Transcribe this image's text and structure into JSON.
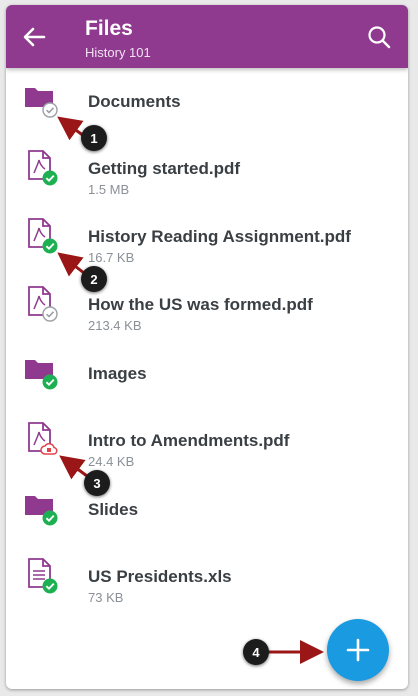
{
  "header": {
    "title": "Files",
    "subtitle": "History 101"
  },
  "colors": {
    "appbar": "#8f3a8e",
    "accent": "#8f3a8e",
    "synced": "#1db052",
    "unsynced": "#9aa0a6",
    "error": "#e0434a",
    "fab": "#1a9ae0",
    "callout_arrow": "#9b1616"
  },
  "files": [
    {
      "name": "Documents",
      "size": "",
      "kind": "folder",
      "status": "unsynced"
    },
    {
      "name": "Getting started.pdf",
      "size": "1.5 MB",
      "kind": "pdf",
      "status": "synced"
    },
    {
      "name": "History Reading Assignment.pdf",
      "size": "16.7 KB",
      "kind": "pdf",
      "status": "synced"
    },
    {
      "name": "How the US was formed.pdf",
      "size": "213.4 KB",
      "kind": "pdf",
      "status": "unsynced"
    },
    {
      "name": "Images",
      "size": "",
      "kind": "folder",
      "status": "synced"
    },
    {
      "name": "Intro to Amendments.pdf",
      "size": "24.4 KB",
      "kind": "pdf",
      "status": "error"
    },
    {
      "name": "Slides",
      "size": "",
      "kind": "folder",
      "status": "synced"
    },
    {
      "name": "US Presidents.xls",
      "size": "73 KB",
      "kind": "xls",
      "status": "synced"
    }
  ],
  "callouts": [
    "1",
    "2",
    "3",
    "4"
  ],
  "icons": {
    "back": "arrow-left-icon",
    "search": "search-icon",
    "add": "plus-icon"
  }
}
